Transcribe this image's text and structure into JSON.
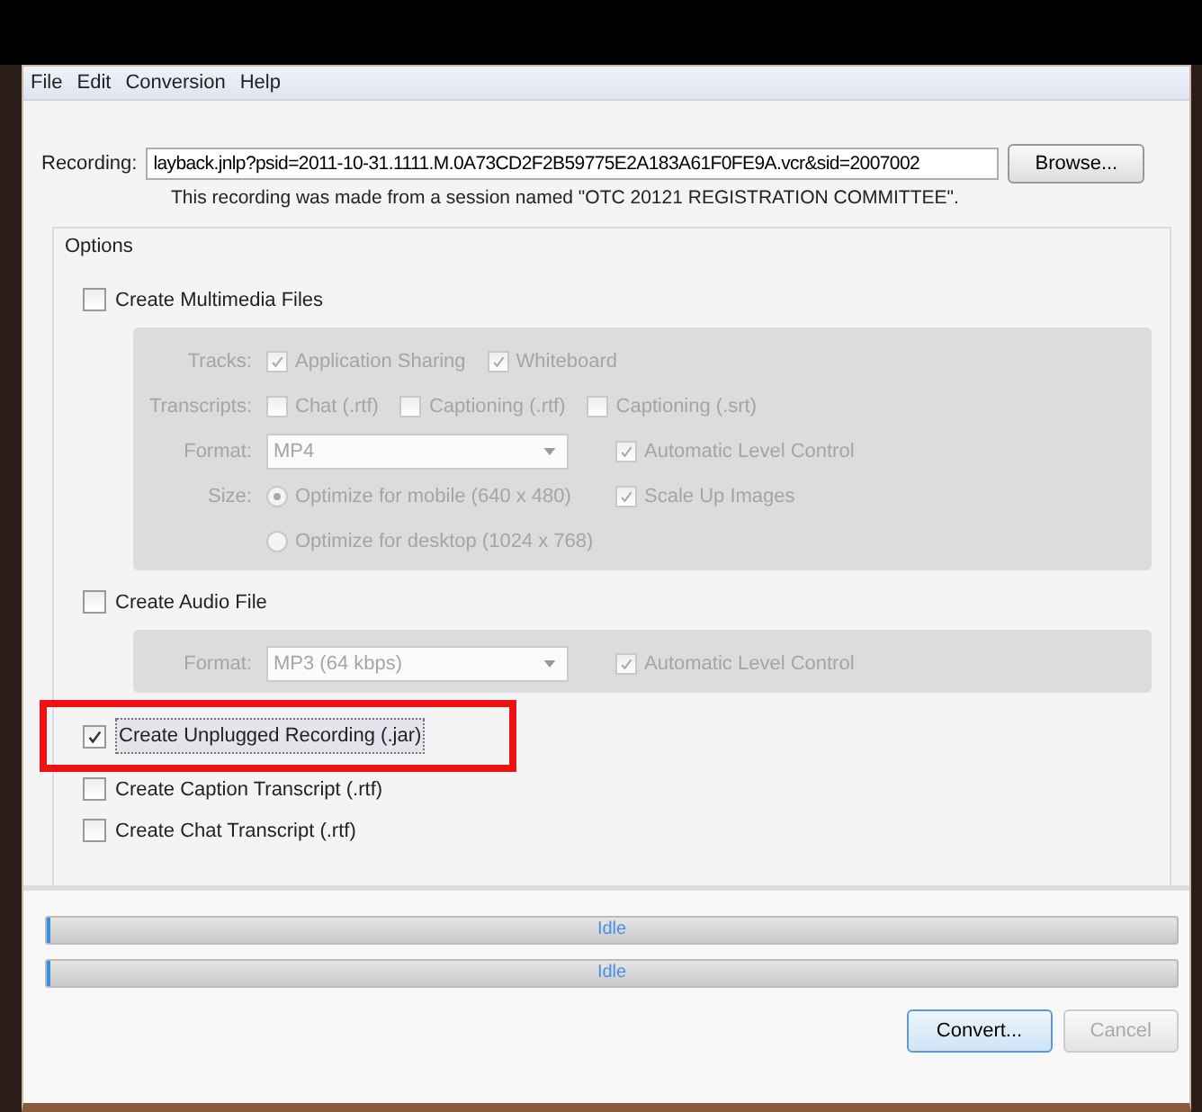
{
  "menu": [
    "File",
    "Edit",
    "Conversion",
    "Help"
  ],
  "recording": {
    "label": "Recording:",
    "value": "layback.jnlp?psid=2011-10-31.1111.M.0A73CD2F2B59775E2A183A61F0FE9A.vcr&sid=2007002",
    "note": "This recording was made from a session named \"OTC 20121 REGISTRATION COMMITTEE\"."
  },
  "browse_button": "Browse...",
  "options": {
    "title": "Options",
    "items": [
      {
        "text": "Create Multimedia Files",
        "checked": false,
        "highlighted": false,
        "group": {
          "disabled": true,
          "rows": [
            {
              "label": "Tracks:",
              "items": [
                {
                  "kind": "checkbox",
                  "text": "Application Sharing",
                  "checked": true
                },
                {
                  "kind": "checkbox",
                  "text": "Whiteboard",
                  "checked": true
                }
              ]
            },
            {
              "label": "Transcripts:",
              "items": [
                {
                  "kind": "checkbox",
                  "text": "Chat (.rtf)",
                  "checked": false
                },
                {
                  "kind": "checkbox",
                  "text": "Captioning (.rtf)",
                  "checked": false
                },
                {
                  "kind": "checkbox",
                  "text": "Captioning (.srt)",
                  "checked": false
                }
              ]
            },
            {
              "label": "Format:",
              "items": [
                {
                  "kind": "select",
                  "value": "MP4"
                },
                {
                  "kind": "checkbox",
                  "text": "Automatic Level Control",
                  "checked": true
                }
              ]
            },
            {
              "label": "Size:",
              "items": [
                {
                  "kind": "radio",
                  "text": "Optimize for mobile (640 x 480)",
                  "selected": true
                },
                {
                  "kind": "checkbox",
                  "text": "Scale Up Images",
                  "checked": true
                }
              ]
            },
            {
              "items": [
                {
                  "kind": "radio",
                  "text": "Optimize for desktop (1024 x 768)",
                  "selected": false
                }
              ]
            }
          ]
        }
      },
      {
        "text": "Create Audio File",
        "checked": false,
        "highlighted": false,
        "group": {
          "disabled": true,
          "rows": [
            {
              "label": "Format:",
              "items": [
                {
                  "kind": "select",
                  "value": "MP3 (64 kbps)"
                },
                {
                  "kind": "checkbox",
                  "text": "Automatic Level Control",
                  "checked": true
                }
              ]
            }
          ]
        }
      },
      {
        "text": "Create Unplugged Recording (.jar)",
        "checked": true,
        "highlighted": true
      },
      {
        "text": "Create Caption Transcript (.rtf)",
        "checked": false,
        "highlighted": false
      },
      {
        "text": "Create Chat Transcript (.rtf)",
        "checked": false,
        "highlighted": false
      }
    ]
  },
  "progress": [
    {
      "text": "Idle",
      "level": 0.003
    },
    {
      "text": "Idle",
      "level": 0.003
    }
  ],
  "buttons": [
    {
      "text": "Convert...",
      "disabled": false
    },
    {
      "text": "Cancel",
      "disabled": true
    }
  ]
}
